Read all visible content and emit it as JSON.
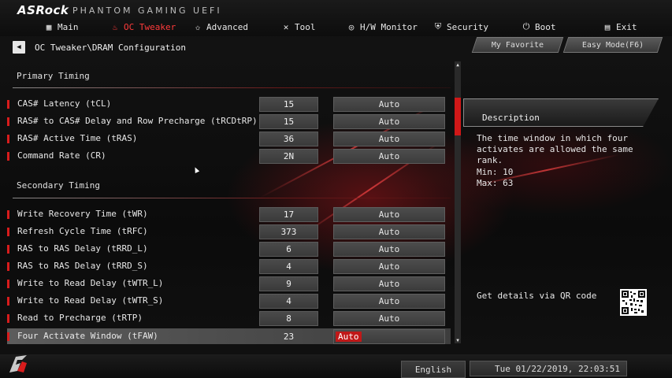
{
  "header": {
    "brand": "ASRock",
    "brand_sub": "PHANTOM GAMING UEFI",
    "nav": [
      {
        "label": "Main",
        "icon": "grid-icon"
      },
      {
        "label": "OC Tweaker",
        "icon": "flame-icon",
        "active": true
      },
      {
        "label": "Advanced",
        "icon": "star-icon"
      },
      {
        "label": "Tool",
        "icon": "tools-icon"
      },
      {
        "label": "H/W Monitor",
        "icon": "monitor-icon"
      },
      {
        "label": "Security",
        "icon": "shield-icon"
      },
      {
        "label": "Boot",
        "icon": "power-icon"
      },
      {
        "label": "Exit",
        "icon": "exit-icon"
      }
    ]
  },
  "breadcrumb": "OC Tweaker\\DRAM Configuration",
  "buttons": {
    "favorite": "My Favorite",
    "easy_mode": "Easy Mode(F6)"
  },
  "sections": {
    "primary": "Primary Timing",
    "secondary": "Secondary Timing"
  },
  "primary_rows": [
    {
      "label": "CAS# Latency (tCL)",
      "value": "15",
      "option": "Auto"
    },
    {
      "label": "RAS# to CAS# Delay and Row Precharge (tRCDtRP)",
      "value": "15",
      "option": "Auto"
    },
    {
      "label": "RAS# Active Time (tRAS)",
      "value": "36",
      "option": "Auto"
    },
    {
      "label": "Command Rate (CR)",
      "value": "2N",
      "option": "Auto"
    }
  ],
  "secondary_rows": [
    {
      "label": "Write Recovery Time (tWR)",
      "value": "17",
      "option": "Auto"
    },
    {
      "label": "Refresh Cycle Time (tRFC)",
      "value": "373",
      "option": "Auto"
    },
    {
      "label": "RAS to RAS Delay (tRRD_L)",
      "value": "6",
      "option": "Auto"
    },
    {
      "label": "RAS to RAS Delay (tRRD_S)",
      "value": "4",
      "option": "Auto"
    },
    {
      "label": "Write to Read Delay (tWTR_L)",
      "value": "9",
      "option": "Auto"
    },
    {
      "label": "Write to Read Delay (tWTR_S)",
      "value": "4",
      "option": "Auto"
    },
    {
      "label": "Read to Precharge (tRTP)",
      "value": "8",
      "option": "Auto"
    },
    {
      "label": "Four Activate Window (tFAW)",
      "value": "23",
      "option": "Auto",
      "selected": true
    }
  ],
  "description": {
    "title": "Description",
    "text": "The time window in which four activates are allowed the same rank.",
    "min": "Min: 10",
    "max": "Max: 63",
    "qr_text": "Get details via QR code"
  },
  "footer": {
    "language": "English",
    "datetime": "Tue 01/22/2019, 22:03:51"
  },
  "colors": {
    "accent": "#d81c1c",
    "background": "#0b0b0b"
  }
}
